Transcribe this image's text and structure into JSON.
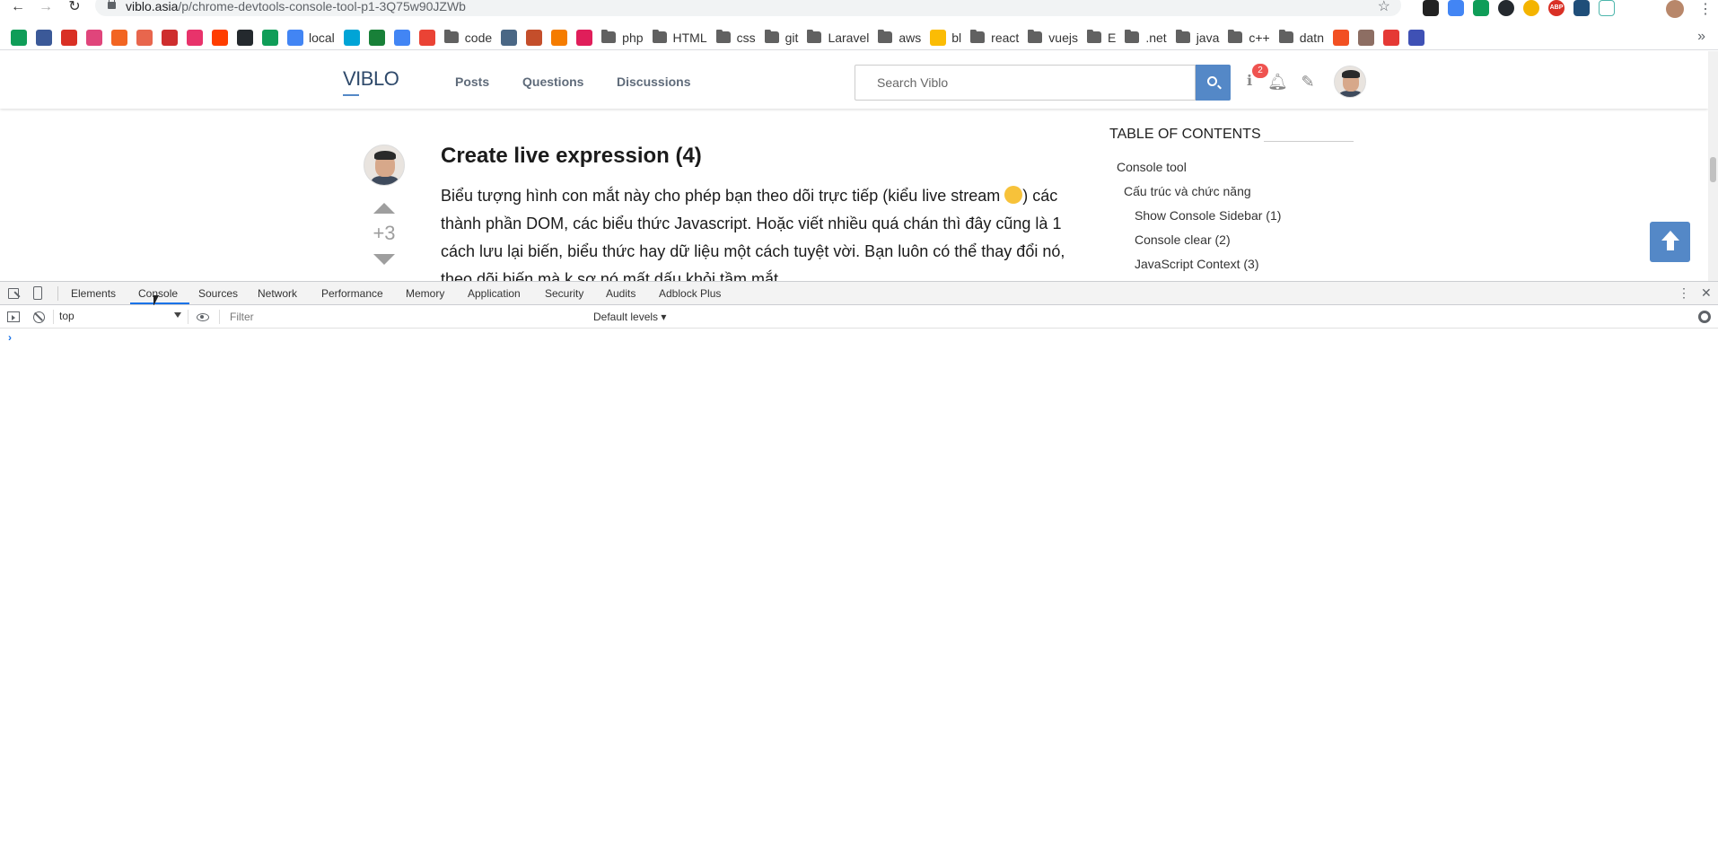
{
  "browser": {
    "url_host": "viblo.asia",
    "url_path": "/p/chrome-devtools-console-tool-p1-3Q75w90JZWb"
  },
  "bookmarks": [
    {
      "label": "",
      "type": "icon",
      "color": "#0f9d58"
    },
    {
      "label": "",
      "type": "icon",
      "color": "#3b5998"
    },
    {
      "label": "",
      "type": "icon",
      "color": "#d93025"
    },
    {
      "label": "",
      "type": "icon",
      "color": "#e0457b"
    },
    {
      "label": "",
      "type": "icon",
      "color": "#f26522"
    },
    {
      "label": "",
      "type": "icon",
      "color": "#e8664d"
    },
    {
      "label": "",
      "type": "icon",
      "color": "#ce2e2e"
    },
    {
      "label": "",
      "type": "icon",
      "color": "#e8336b"
    },
    {
      "label": "",
      "type": "icon",
      "color": "#ff3d00"
    },
    {
      "label": "",
      "type": "icon",
      "color": "#24292e"
    },
    {
      "label": "",
      "type": "icon",
      "color": "#0f9d58"
    },
    {
      "label": "local",
      "type": "icon",
      "color": "#4285f4"
    },
    {
      "label": "",
      "type": "icon",
      "color": "#00a4d6"
    },
    {
      "label": "",
      "type": "icon",
      "color": "#188038"
    },
    {
      "label": "",
      "type": "icon",
      "color": "#4285f4"
    },
    {
      "label": "",
      "type": "icon",
      "color": "#ea4335"
    },
    {
      "label": "code",
      "type": "folder"
    },
    {
      "label": "",
      "type": "icon",
      "color": "#4a6785"
    },
    {
      "label": "",
      "type": "icon",
      "color": "#c44e2b"
    },
    {
      "label": "",
      "type": "icon",
      "color": "#f57c00"
    },
    {
      "label": "",
      "type": "icon",
      "color": "#e01e5a"
    },
    {
      "label": "php",
      "type": "folder"
    },
    {
      "label": "HTML",
      "type": "folder"
    },
    {
      "label": "css",
      "type": "folder"
    },
    {
      "label": "git",
      "type": "folder"
    },
    {
      "label": "Laravel",
      "type": "folder"
    },
    {
      "label": "aws",
      "type": "folder"
    },
    {
      "label": "bl",
      "type": "icon",
      "color": "#fbbc04"
    },
    {
      "label": "react",
      "type": "folder"
    },
    {
      "label": "vuejs",
      "type": "folder"
    },
    {
      "label": "E",
      "type": "folder"
    },
    {
      "label": ".net",
      "type": "folder"
    },
    {
      "label": "java",
      "type": "folder"
    },
    {
      "label": "c++",
      "type": "folder"
    },
    {
      "label": "datn",
      "type": "folder"
    },
    {
      "label": "",
      "type": "icon",
      "color": "#f25022"
    },
    {
      "label": "",
      "type": "icon",
      "color": "#8d6e63"
    },
    {
      "label": "",
      "type": "icon",
      "color": "#e53935"
    },
    {
      "label": "",
      "type": "icon",
      "color": "#3f51b5"
    }
  ],
  "bookmarks_more": "»",
  "site": {
    "logo": "VIBLO",
    "nav": [
      "Posts",
      "Questions",
      "Discussions"
    ],
    "search_placeholder": "Search Viblo",
    "notification_count": "2"
  },
  "article": {
    "title": "Create live expression (4)",
    "body_part1": "Biểu tượng hình con mắt này cho phép bạn theo dõi trực tiếp (kiểu live stream ",
    "body_part2": ") các thành phần DOM, các biểu thức Javascript. Hoặc viết nhiều quá chán thì đây cũng là 1 cách lưu lại biến, biểu thức hay dữ liệu một cách tuyệt vời. Bạn luôn có thể thay đổi nó, theo dõi biến mà k sợ nó mất dấu khỏi tầm mắt.",
    "vote_count": "+3"
  },
  "toc": {
    "title": "TABLE OF CONTENTS",
    "items": [
      {
        "label": "Console tool",
        "level": 0
      },
      {
        "label": "Cấu trúc và chức năng",
        "level": 1
      },
      {
        "label": "Show Console Sidebar (1)",
        "level": 2
      },
      {
        "label": "Console clear (2)",
        "level": 2
      },
      {
        "label": "JavaScript Context (3)",
        "level": 2
      }
    ]
  },
  "devtools": {
    "tabs": [
      "Elements",
      "Console",
      "Sources",
      "Network",
      "Performance",
      "Memory",
      "Application",
      "Security",
      "Audits",
      "Adblock Plus"
    ],
    "active_tab": "Console",
    "context": "top",
    "filter_placeholder": "Filter",
    "levels": "Default levels",
    "prompt": "›"
  }
}
